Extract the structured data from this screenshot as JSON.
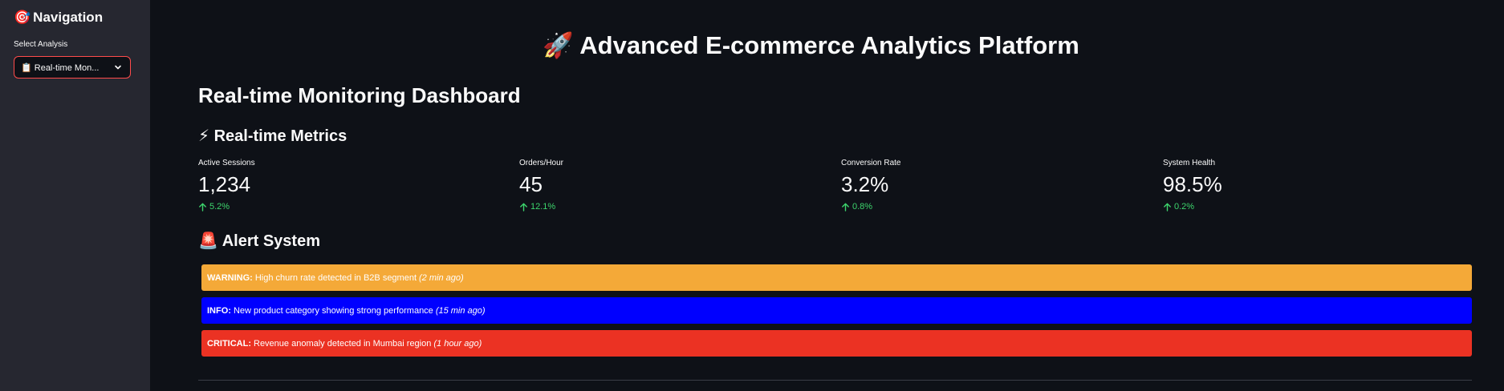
{
  "sidebar": {
    "title_emoji": "🎯",
    "title": "Navigation",
    "select_label": "Select Analysis",
    "select_value": "📋 Real-time Mon..."
  },
  "main": {
    "page_title": "🚀 Advanced E-commerce Analytics Platform",
    "section_title": "Real-time Monitoring Dashboard",
    "metrics_title": "⚡ Real-time Metrics",
    "metrics": [
      {
        "label": "Active Sessions",
        "value": "1,234",
        "delta": "5.2%"
      },
      {
        "label": "Orders/Hour",
        "value": "45",
        "delta": "12.1%"
      },
      {
        "label": "Conversion Rate",
        "value": "3.2%",
        "delta": "0.8%"
      },
      {
        "label": "System Health",
        "value": "98.5%",
        "delta": "0.2%"
      }
    ],
    "alerts_title": "🚨 Alert System",
    "alerts": [
      {
        "level": "WARNING:",
        "message": "High churn rate detected in B2B segment",
        "time": "(2 min ago)"
      },
      {
        "level": "INFO:",
        "message": "New product category showing strong performance",
        "time": "(15 min ago)"
      },
      {
        "level": "CRITICAL:",
        "message": "Revenue anomaly detected in Mumbai region",
        "time": "(1 hour ago)"
      }
    ]
  },
  "colors": {
    "background": "#0e1117",
    "sidebar": "#262730",
    "accent": "#ff4b4b",
    "delta_positive": "#3dd56d",
    "warning": "#f4a938",
    "info": "#0000ff",
    "critical": "#eb3223"
  },
  "icons": [
    "target-icon",
    "chevron-down-icon",
    "arrow-up-icon"
  ]
}
